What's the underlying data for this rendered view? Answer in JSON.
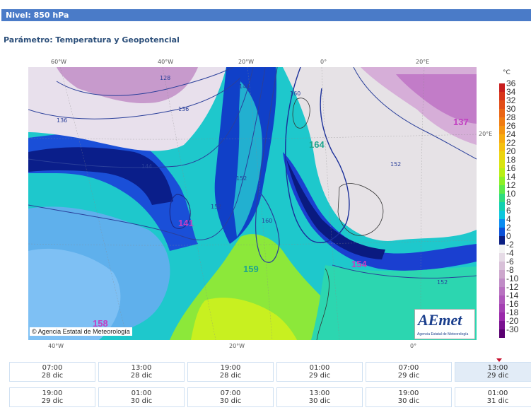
{
  "header": {
    "level": "Nivel: 850 hPa"
  },
  "parameter": "Parámetro: Temperatura y Geopotencial",
  "map": {
    "top_ticks": [
      "60°W",
      "40°W",
      "20°W",
      "0°",
      "20°E"
    ],
    "bottom_ticks": [
      "40°W",
      "20°W",
      "0°"
    ],
    "right_tick": "20°E",
    "highs": [
      "164",
      "159",
      "154"
    ],
    "lows": [
      "137",
      "141",
      "158"
    ],
    "contour_labels": [
      "128",
      "136",
      "136",
      "144",
      "144",
      "152",
      "152",
      "160",
      "160",
      "152",
      "152"
    ],
    "copyright": "© Agencia Estatal de Meteorología",
    "logo_main": "AEmet",
    "logo_sub": "Agencia Estatal de Meteorología",
    "colors": {
      "high": "#1fa58f",
      "low": "#c23fc2"
    }
  },
  "legend": {
    "unit": "°C",
    "labels": [
      "36",
      "34",
      "32",
      "30",
      "28",
      "26",
      "24",
      "22",
      "20",
      "18",
      "16",
      "14",
      "12",
      "10",
      "8",
      "6",
      "4",
      "2",
      "0",
      "-2",
      "-4",
      "-6",
      "-8",
      "-10",
      "-12",
      "-14",
      "-16",
      "-18",
      "-20",
      "-30"
    ],
    "colors": [
      "#c81e1e",
      "#d8351a",
      "#e24d17",
      "#ea6514",
      "#f07c12",
      "#f49410",
      "#f7ab0f",
      "#f5c00f",
      "#ecd40f",
      "#d8e40f",
      "#b8ee15",
      "#8cf026",
      "#5cea4a",
      "#2fdc80",
      "#12d0b0",
      "#0cc6dc",
      "#0a8cf0",
      "#0a50d8",
      "#0a1e82",
      "#f4f4f4",
      "#e6dbe6",
      "#d8c0d8",
      "#cca6cc",
      "#c08cc6",
      "#b872c0",
      "#ae58ba",
      "#a440b2",
      "#9a28aa",
      "#7a1090",
      "#5a0070"
    ]
  },
  "timeline": {
    "row1": [
      {
        "time": "07:00",
        "date": "28 dic"
      },
      {
        "time": "13:00",
        "date": "28 dic"
      },
      {
        "time": "19:00",
        "date": "28 dic"
      },
      {
        "time": "01:00",
        "date": "29 dic"
      },
      {
        "time": "07:00",
        "date": "29 dic"
      },
      {
        "time": "13:00",
        "date": "29 dic"
      }
    ],
    "row2": [
      {
        "time": "19:00",
        "date": "29 dic"
      },
      {
        "time": "01:00",
        "date": "30 dic"
      },
      {
        "time": "07:00",
        "date": "30 dic"
      },
      {
        "time": "13:00",
        "date": "30 dic"
      },
      {
        "time": "19:00",
        "date": "30 dic"
      },
      {
        "time": "01:00",
        "date": "31 dic"
      }
    ],
    "active": "13:00 29 dic"
  }
}
